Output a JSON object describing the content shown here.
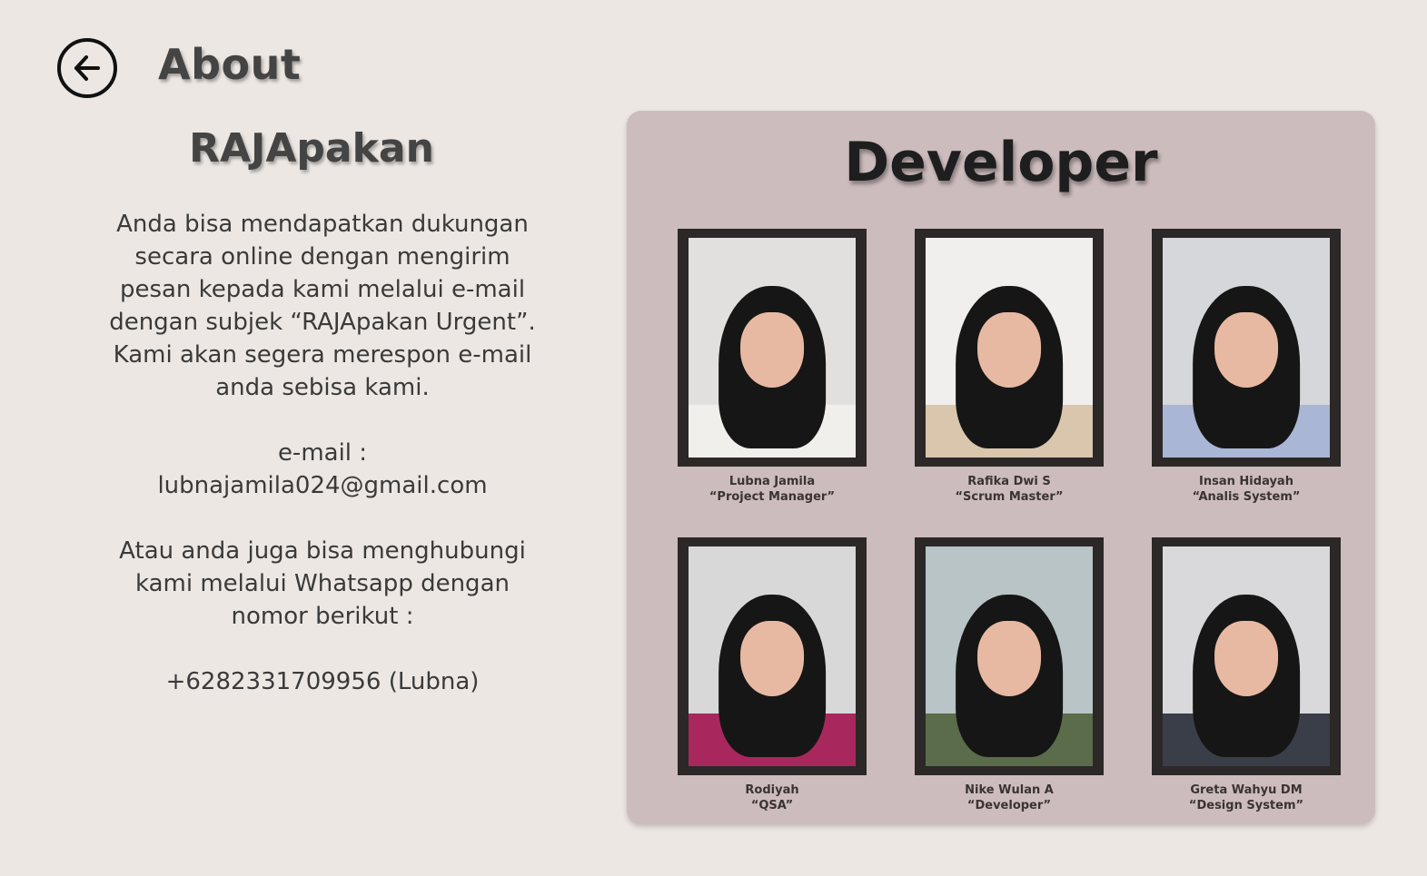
{
  "header": {
    "title": "About",
    "back_icon": "arrow-left-circle-icon"
  },
  "info": {
    "app_name": "RAJApakan",
    "paragraph1": "Anda bisa mendapatkan dukungan secara online dengan mengirim pesan kepada kami melalui e-mail dengan subjek “RAJApakan Urgent”. Kami akan segera merespon e-mail anda sebisa kami.",
    "email_label": "e-mail :",
    "email": "lubnajamila024@gmail.com",
    "paragraph2": "Atau anda juga bisa menghubungi kami melalui Whatsapp dengan nomor berikut :",
    "phone": "+6282331709956 (Lubna)"
  },
  "developer": {
    "title": "Developer",
    "members": [
      {
        "name": "Lubna Jamila",
        "role": "“Project Manager”",
        "bg": "#e2e0de",
        "body": "#f1efec"
      },
      {
        "name": "Rafika Dwi S",
        "role": "“Scrum Master”",
        "bg": "#f0efee",
        "body": "#d9c6ad"
      },
      {
        "name": "Insan Hidayah",
        "role": "“Analis System”",
        "bg": "#d5d7da",
        "body": "#aab6d6"
      },
      {
        "name": "Rodiyah",
        "role": "“QSA”",
        "bg": "#d8d8d8",
        "body": "#a8285e"
      },
      {
        "name": "Nike Wulan A",
        "role": "“Developer”",
        "bg": "#b8c4c6",
        "body": "#5a6c4a"
      },
      {
        "name": "Greta Wahyu DM",
        "role": "“Design System”",
        "bg": "#d9d9db",
        "body": "#3a3e48"
      }
    ]
  },
  "colors": {
    "background": "#ece7e3",
    "panel": "#cdbcbd",
    "frame": "#2b2827"
  }
}
